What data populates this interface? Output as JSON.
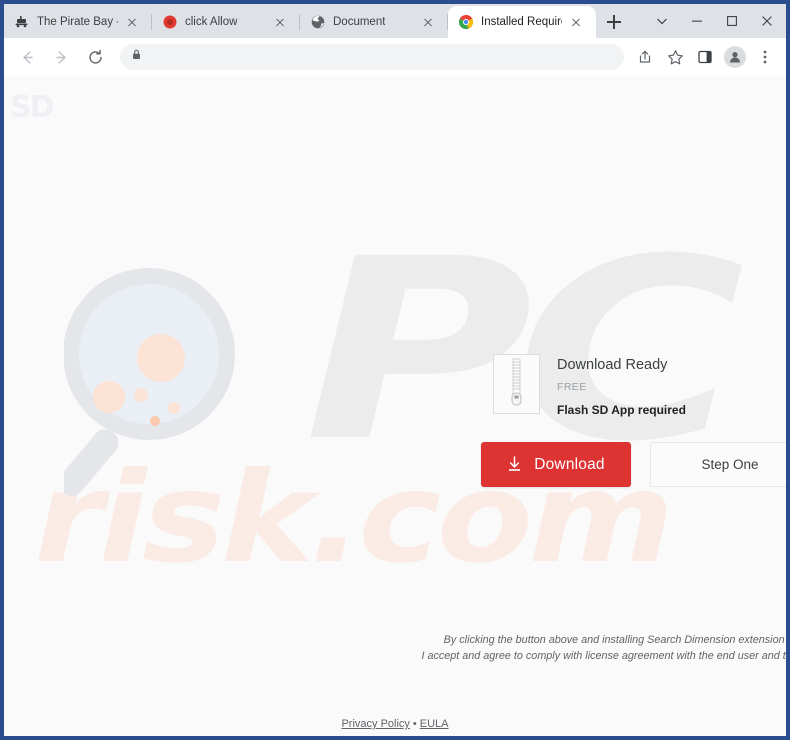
{
  "window": {
    "controls": {
      "tab_search_label": "⌄",
      "minimize_label": "–",
      "maximize_label": "□",
      "close_label": "✕"
    }
  },
  "tabs": [
    {
      "title": "The Pirate Bay - The gal",
      "favicon": "pirate-ship-icon",
      "active": false
    },
    {
      "title": "click Allow",
      "favicon": "red-dot-icon",
      "active": false
    },
    {
      "title": "Document",
      "favicon": "globe-icon",
      "active": false
    },
    {
      "title": "Installed Required",
      "favicon": "chrome-icon",
      "active": true
    }
  ],
  "newtab": {
    "label": "+"
  },
  "toolbar": {
    "back_label": "←",
    "forward_label": "→",
    "reload_label": "⟳",
    "lock_label": "🔒",
    "url": "",
    "url_placeholder": "",
    "share_label": "↱",
    "bookmark_label": "☆",
    "sidepanel_label": "▯",
    "profile_label": "●",
    "menu_label": "⋮"
  },
  "page": {
    "sd_logo": "SD",
    "watermark_pc": "PC",
    "watermark_risk": "risk.com",
    "download": {
      "title": "Download Ready",
      "price": "FREE",
      "requirement": "Flash SD App required",
      "zip_icon": "zip-file-icon"
    },
    "buttons": {
      "download_label": "Download",
      "download_icon": "download-arrow-icon",
      "step_one_label": "Step One"
    },
    "fineprint": [
      "By clicking the button above and installing Search Dimension extension for omnibox",
      "I accept and agree to comply with license agreement with the end user and the privacy p"
    ],
    "footer": {
      "privacy_label": "Privacy Policy",
      "separator": "•",
      "eula_label": "EULA"
    }
  },
  "colors": {
    "frame_border": "#2a4d8f",
    "download_button": "#dd3333",
    "chrome_bg": "#dee1e6",
    "page_bg": "#fafafa",
    "watermark_pc": "#ececec",
    "watermark_risk": "#fbebe5"
  }
}
